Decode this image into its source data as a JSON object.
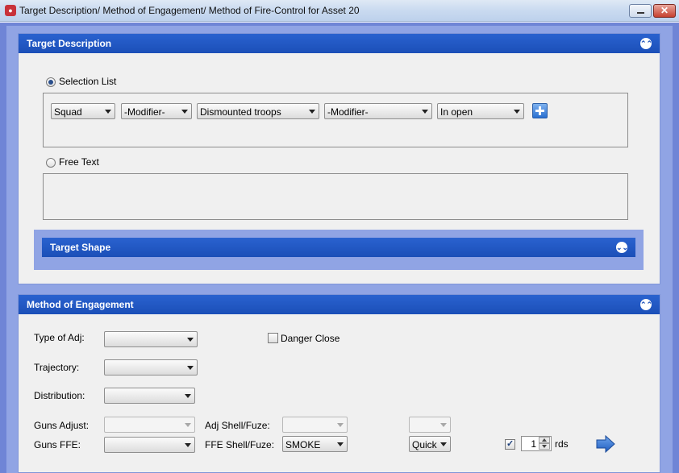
{
  "window": {
    "title": "Target Description/ Method of Engagement/ Method of Fire-Control for Asset 20",
    "icons": {
      "app": "app-icon",
      "minimize": "minimize-icon",
      "close": "close-icon"
    }
  },
  "target_description": {
    "header": "Target Description",
    "selection_list_label": "Selection List",
    "selection_list_selected": true,
    "combos": [
      "Squad",
      "-Modifier-",
      "Dismounted troops",
      "-Modifier-",
      "In open"
    ],
    "add_icon": "plus-icon",
    "free_text_label": "Free Text",
    "free_text_selected": false,
    "free_text_value": "",
    "target_shape_header": "Target Shape"
  },
  "method_of_engagement": {
    "header": "Method of Engagement",
    "type_of_adj_label": "Type of Adj:",
    "type_of_adj_value": "",
    "danger_close_label": "Danger Close",
    "danger_close_checked": false,
    "trajectory_label": "Trajectory:",
    "trajectory_value": "",
    "distribution_label": "Distribution:",
    "distribution_value": "",
    "guns_adjust_label": "Guns Adjust:",
    "guns_adjust_value": "",
    "adj_shell_fuze_label": "Adj Shell/Fuze:",
    "adj_shell_value": "",
    "adj_fuze_value": "",
    "guns_ffe_label": "Guns FFE:",
    "guns_ffe_value": "",
    "ffe_shell_fuze_label": "FFE Shell/Fuze:",
    "ffe_shell_value": "SMOKE",
    "ffe_fuze_value": "Quick",
    "rds_checked": true,
    "rds_value": "1",
    "rds_label": "rds",
    "next_icon": "arrow-right-icon"
  },
  "colors": {
    "header_blue": "#1b4fb8",
    "frame_blue": "#6f85d6",
    "panel_bg": "#f0f0f0"
  }
}
